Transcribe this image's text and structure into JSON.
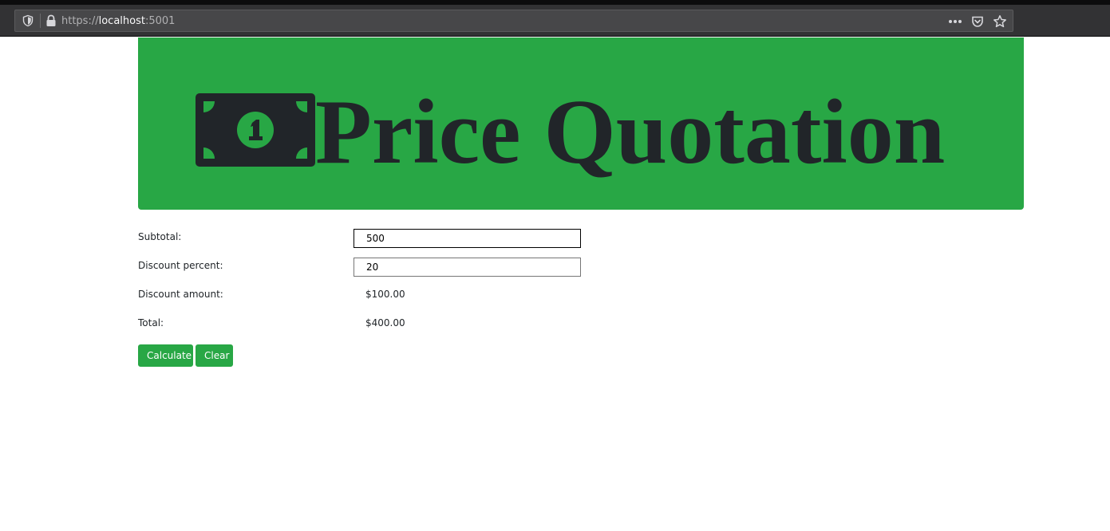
{
  "browser": {
    "url_scheme": "https://",
    "url_host": "localhost",
    "url_port": ":5001",
    "icons": [
      "shield-icon",
      "lock-icon",
      "more-icon",
      "pocket-icon",
      "star-icon"
    ]
  },
  "header": {
    "icon": "money-bill-icon",
    "title": "Price Quotation",
    "background_color": "#28a745",
    "text_color": "#212529"
  },
  "form": {
    "subtotal_label": "Subtotal:",
    "subtotal_value": "500",
    "discount_percent_label": "Discount percent:",
    "discount_percent_value": "20",
    "discount_amount_label": "Discount amount:",
    "discount_amount_value": "$100.00",
    "total_label": "Total:",
    "total_value": "$400.00"
  },
  "buttons": {
    "calculate_label": "Calculate",
    "clear_label": "Clear",
    "color": "#28a745"
  }
}
